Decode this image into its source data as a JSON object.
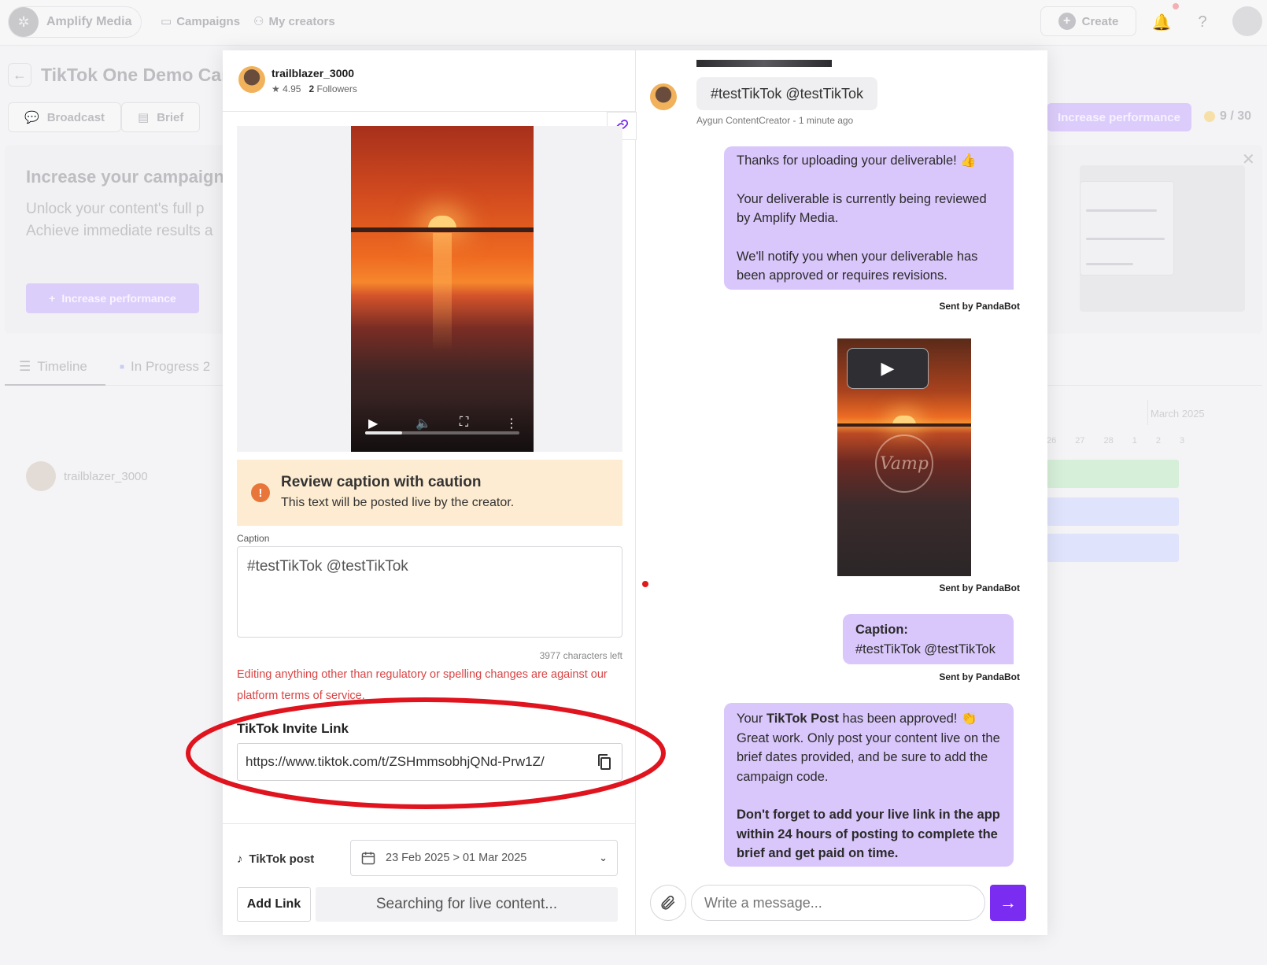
{
  "app": {
    "brand": "Amplify Media",
    "nav": [
      "Campaigns",
      "My creators"
    ],
    "create_label": "Create"
  },
  "campaign": {
    "title": "TikTok One Demo Campaign",
    "tabs": [
      "Broadcast",
      "Brief"
    ],
    "increase_performance": "Increase performance",
    "counter": "9 / 30"
  },
  "promo": {
    "heading": "Increase your campaign",
    "line1": "Unlock your content's full p",
    "line2": "Achieve immediate results a",
    "button": "Increase performance"
  },
  "timeline": {
    "tab_timeline": "Timeline",
    "tab_progress": "In Progress 2",
    "creator": "trailblazer_3000",
    "month": "March 2025",
    "days": [
      "26",
      "27",
      "28",
      "1",
      "2",
      "3"
    ],
    "gantt_colors": [
      "#d6efd9",
      "#dfe3fb",
      "#dfe3fb"
    ]
  },
  "creator": {
    "username": "trailblazer_3000",
    "rating": "4.95",
    "followers_count": "2",
    "followers_label": "Followers"
  },
  "review": {
    "warning_title": "Review caption with caution",
    "warning_text": "This text will be posted live by the creator.",
    "caption_label": "Caption",
    "caption_value": "#testTikTok @testTikTok",
    "chars_left": "3977 characters left",
    "edit_warning": "Editing anything other than regulatory or spelling changes are against our platform terms of service.",
    "invite_label": "TikTok Invite Link",
    "invite_url": "https://www.tiktok.com/t/ZSHmmsobhjQNd-Prw1Z/",
    "video_progress": 0.24
  },
  "footer": {
    "post_type": "TikTok post",
    "date_range": "23 Feb 2025 > 01 Mar 2025",
    "add_link": "Add Link",
    "searching": "Searching for live content..."
  },
  "chat": {
    "first_message": "#testTikTok @testTikTok",
    "first_meta": "Aygun ContentCreator - 1 minute ago",
    "bubble1": {
      "line1": "Thanks for uploading your deliverable! 👍",
      "line2": "Your deliverable is currently being reviewed by Amplify Media.",
      "line3": "We'll notify you when your deliverable has been approved or requires revisions."
    },
    "sent_by": "Sent by PandaBot",
    "watermark": "Vamp",
    "caption_title": "Caption:",
    "caption_value": "#testTikTok @testTikTok",
    "approved": {
      "prefix": "Your ",
      "bold": "TikTok Post",
      "suffix": " has been approved! 👏 Great work. Only post your content live on the brief dates provided, and be sure to add the campaign code.",
      "reminder": "Don't forget to add your live link in the app within 24 hours of posting to complete the brief and get paid on time."
    },
    "input_placeholder": "Write a message..."
  },
  "colors": {
    "accent": "#7a2df0",
    "bubble": "#d9c6fb",
    "warning_bg": "#fdecd1",
    "warning_icon": "#e8763a",
    "error_text": "#d94545",
    "annotation": "#e0141e"
  }
}
